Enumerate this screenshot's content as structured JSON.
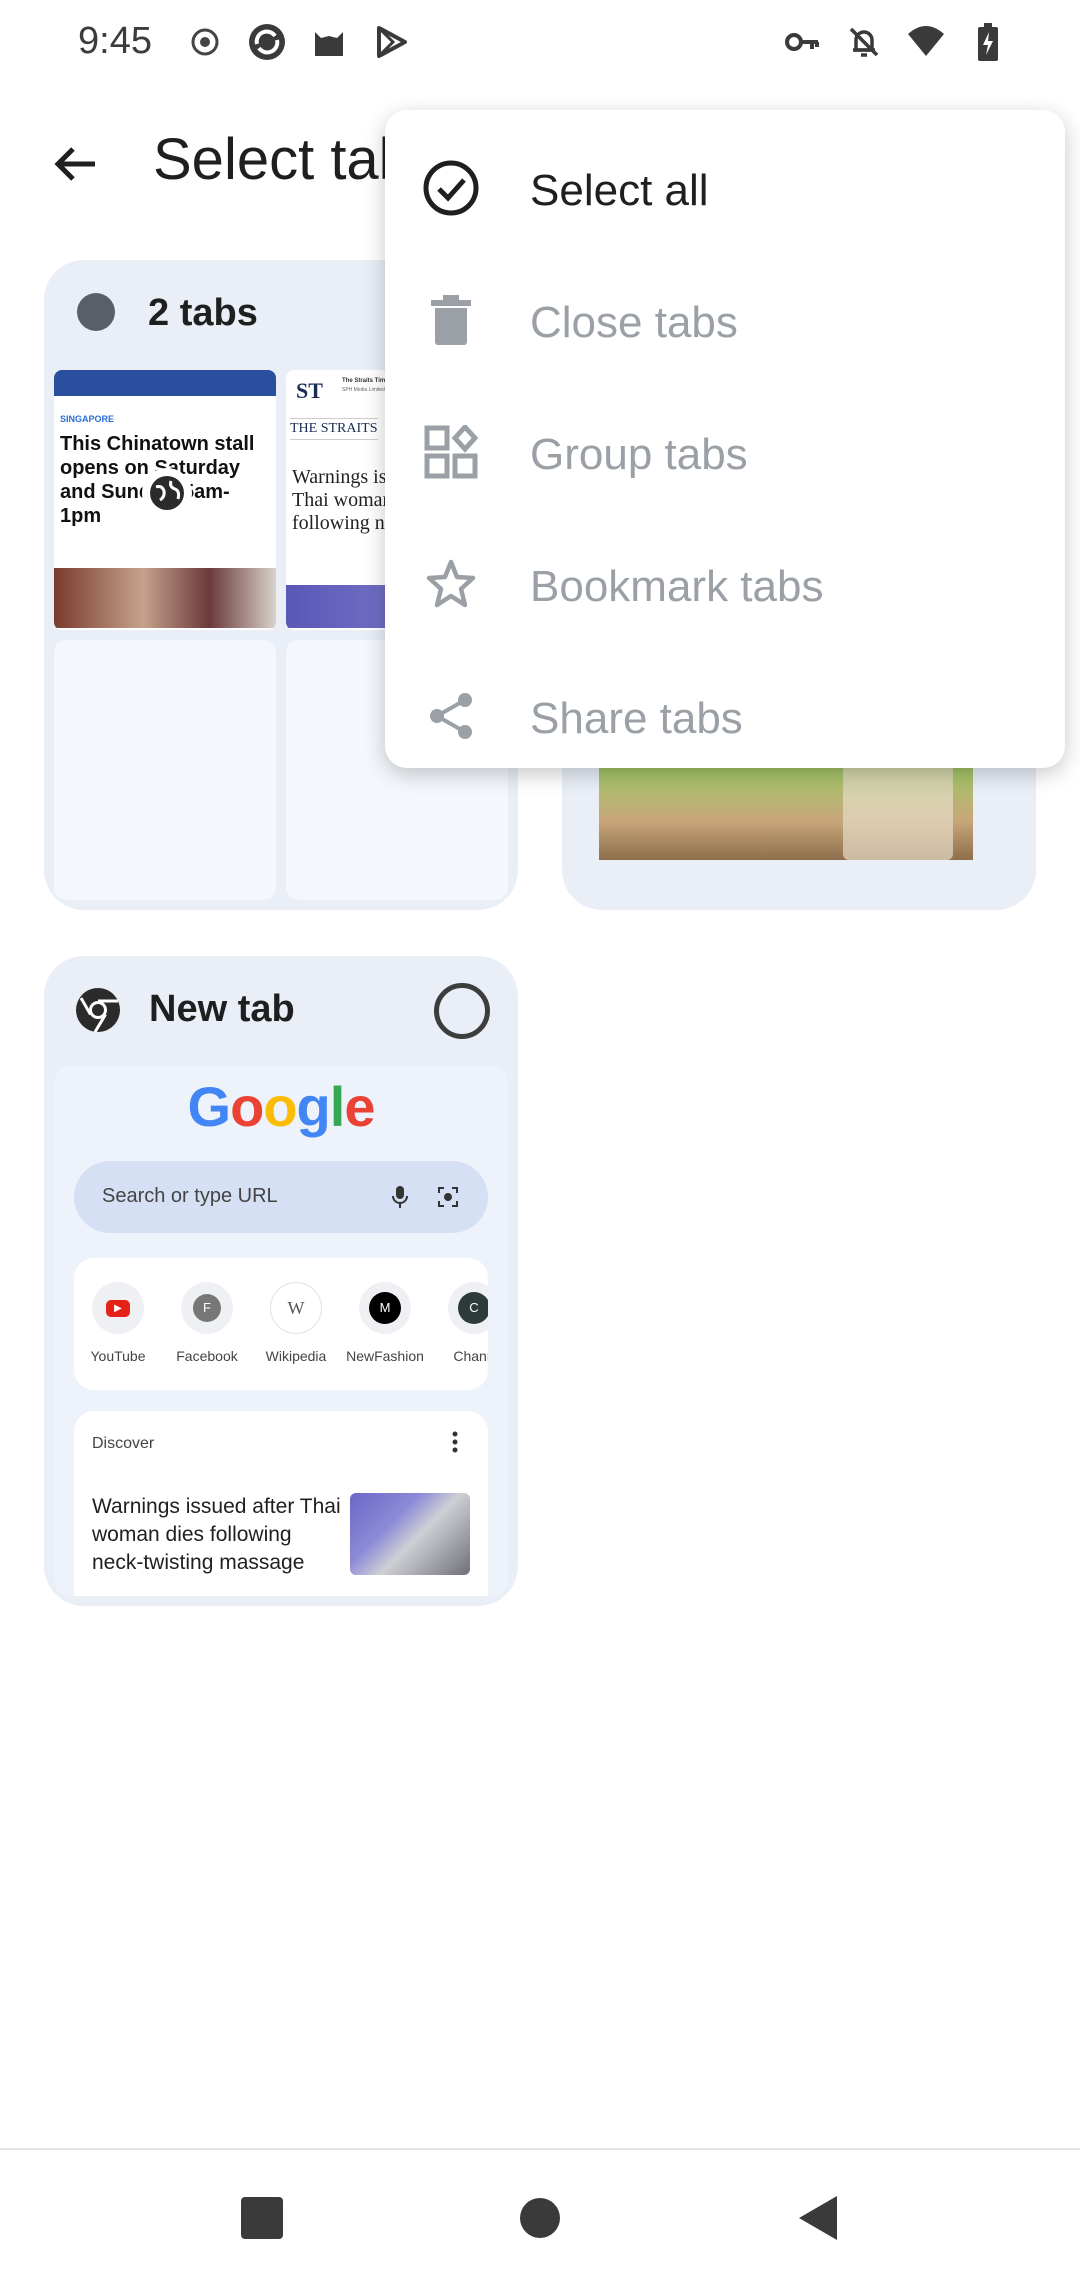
{
  "status_bar": {
    "time": "9:45",
    "left_icons": [
      "record-icon",
      "app-sync-icon",
      "cat-app-icon",
      "play-store-icon"
    ],
    "right_icons": [
      "vpn-key-icon",
      "notifications-off-icon",
      "wifi-icon",
      "battery-charging-icon"
    ]
  },
  "app_bar": {
    "title": "Select tabs",
    "back_icon": "arrow-back-icon"
  },
  "tab_group_card": {
    "title": "2 tabs",
    "thumbnails": [
      {
        "tag": "SINGAPORE",
        "headline": "This Chinatown stall opens on Saturday and Sunday, 5am-1pm"
      },
      {
        "masthead": "THE STRAITS",
        "publisher": "The Straits Times",
        "publisher_sub": "SPH Media Limited",
        "headline": "Warnings issued after Thai woman dies following neck-twisting"
      }
    ]
  },
  "new_tab_card": {
    "title": "New tab",
    "google_logo": "Google",
    "search_placeholder": "Search or type URL",
    "shortcuts": [
      {
        "label": "YouTube",
        "glyph": "▶"
      },
      {
        "label": "Facebook",
        "glyph": "F"
      },
      {
        "label": "Wikipedia",
        "glyph": "W"
      },
      {
        "label": "NewFashion",
        "glyph": "M"
      },
      {
        "label": "Chann",
        "glyph": "C"
      }
    ],
    "discover_label": "Discover",
    "discover_headline": "Warnings issued after Thai woman dies following neck-twisting massage"
  },
  "menu": {
    "items": [
      {
        "label": "Select all",
        "icon": "check-circle-icon",
        "enabled": true
      },
      {
        "label": "Close tabs",
        "icon": "trash-icon",
        "enabled": false
      },
      {
        "label": "Group tabs",
        "icon": "group-tabs-icon",
        "enabled": false
      },
      {
        "label": "Bookmark tabs",
        "icon": "star-icon",
        "enabled": false
      },
      {
        "label": "Share tabs",
        "icon": "share-icon",
        "enabled": false
      }
    ]
  },
  "nav_bar": {
    "buttons": [
      "recents-button",
      "home-button",
      "back-button"
    ]
  },
  "colors": {
    "card_bg": "#e9eef7",
    "text_primary": "#1f1f1f",
    "text_disabled": "#9aa0a6",
    "google_blue": "#4285F4",
    "google_red": "#EA4335",
    "google_yellow": "#FBBC05",
    "google_green": "#34A853"
  }
}
